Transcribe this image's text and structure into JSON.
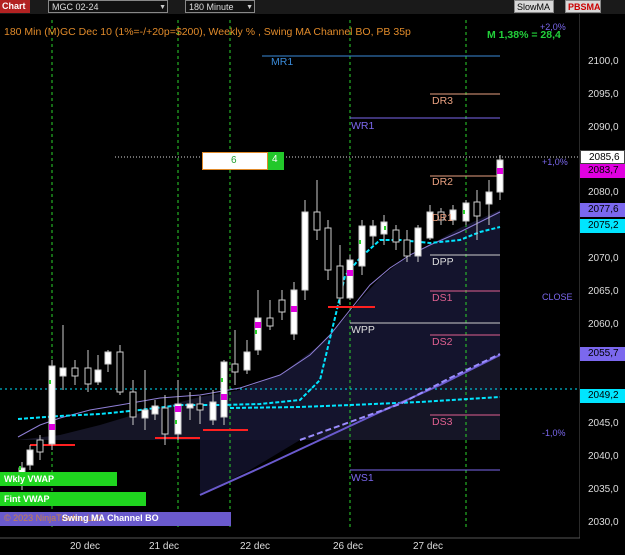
{
  "toolbar": {
    "chart_tab": "Chart",
    "instrument": "MGC 02-24",
    "timeframe": "180 Minute",
    "slow_ma": "SlowMA",
    "pbsma": "PBSMA"
  },
  "header": {
    "title": "180 Min (M)GC Dec 10 (1%=-/+20p=$200), Weekly % , Swing MA Channel BO, PB 35p",
    "stat": "M 1,38% = 28,4",
    "pct_up": "+2,0%",
    "pct_up1": "+1,0%",
    "pct_down1": "-1,0%"
  },
  "price_axis": [
    "2100,0",
    "2095,0",
    "2090,0",
    "2085,0",
    "2080,0",
    "2075,0",
    "2070,0",
    "2065,0",
    "2060,0",
    "2055,0",
    "2050,0",
    "2045,0",
    "2040,0",
    "2035,0",
    "2030,0"
  ],
  "price_badges": {
    "last": "2085,6",
    "magenta": "2083,7",
    "purple1": "2077,6",
    "cyan1": "2075,2",
    "purple2": "2055,7",
    "cyan2": "2049,2"
  },
  "x_axis": [
    "20 dec",
    "21 dec",
    "22 dec",
    "26 dec",
    "27 dec"
  ],
  "levels": {
    "mr1": "MR1",
    "wr1": "WR1",
    "ws1": "WS1",
    "wpp": "WPP",
    "dr3": "DR3",
    "dr2": "DR2",
    "dr1": "DR1",
    "dpp": "DPP",
    "ds1": "DS1",
    "ds2": "DS2",
    "ds3": "DS3",
    "close": "CLOSE"
  },
  "counter": {
    "left": "6",
    "right": "4"
  },
  "labels": {
    "wkly_vwap": "Wkly VWAP",
    "fint_vwap": "Fint VWAP",
    "swing": "Swing MA Channel BO",
    "copyright": "© 2023 NinjaTrader, LLC"
  },
  "colors": {
    "background": "#000000",
    "title": "#e08a2a",
    "green": "#22d03a",
    "cyan": "#00e5ff",
    "purple": "#7b68ee",
    "magenta": "#e000e0"
  }
}
